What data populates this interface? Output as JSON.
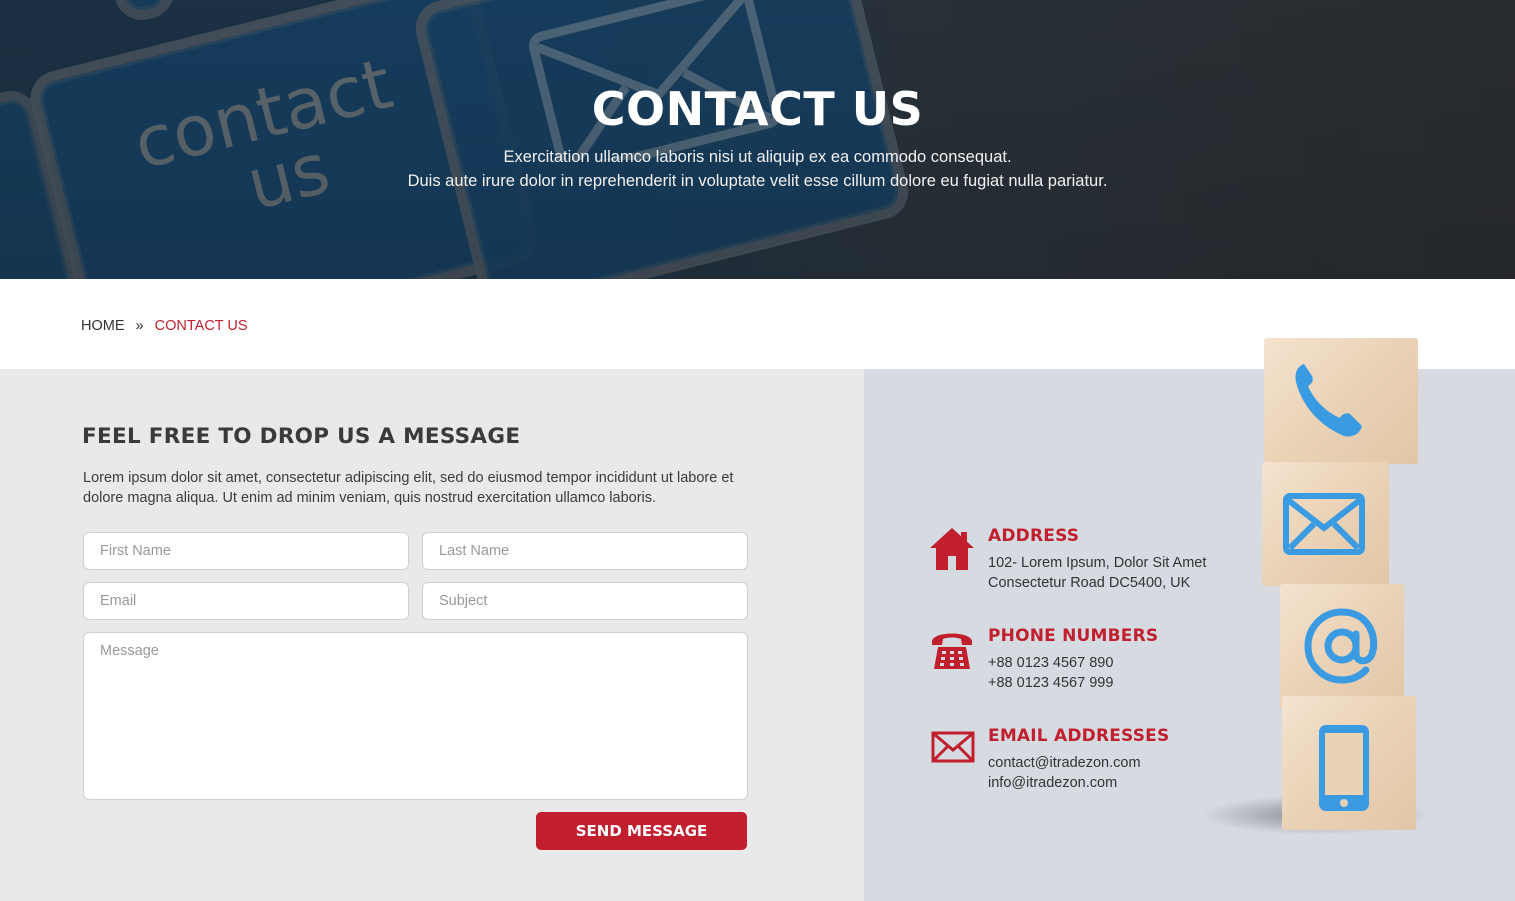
{
  "hero": {
    "title": "CONTACT US",
    "subtitle_line1": "Exercitation ullamco laboris nisi ut aliquip ex ea commodo consequat.",
    "subtitle_line2": "Duis aute irure dolor in reprehenderit in voluptate velit esse cillum dolore eu fugiat nulla pariatur.",
    "background_key_text_line1": "contact",
    "background_key_text_line2": "us"
  },
  "breadcrumb": {
    "home": "HOME",
    "separator": "»",
    "current": "CONTACT US"
  },
  "form": {
    "title": "FEEL FREE TO DROP US A MESSAGE",
    "description": "Lorem ipsum dolor sit amet, consectetur adipiscing elit, sed do eiusmod tempor incididunt ut labore et dolore magna aliqua. Ut enim ad minim veniam, quis nostrud exercitation ullamco laboris.",
    "first_name_placeholder": "First Name",
    "last_name_placeholder": "Last Name",
    "email_placeholder": "Email",
    "subject_placeholder": "Subject",
    "message_placeholder": "Message",
    "submit_label": "SEND MESSAGE"
  },
  "contact_info": {
    "address": {
      "icon": "home-icon",
      "heading": "ADDRESS",
      "line1": "102- Lorem Ipsum, Dolor Sit Amet",
      "line2": "Consectetur Road DC5400, UK"
    },
    "phone": {
      "icon": "telephone-icon",
      "heading": "PHONE NUMBERS",
      "line1": "+88 0123 4567 890",
      "line2": "+88 0123 4567 999"
    },
    "email": {
      "icon": "envelope-icon",
      "heading": "EMAIL ADDRESSES",
      "line1": "contact@itradezon.com",
      "line2": "info@itradezon.com"
    }
  },
  "cubes": {
    "icons": [
      "phone-icon",
      "mail-icon",
      "at-sign-icon",
      "mobile-icon"
    ]
  },
  "colors": {
    "accent": "#c11f2e",
    "cube_icon_blue": "#3a9be2",
    "form_bg": "#e9e9e9",
    "info_bg": "#d6dbe2"
  }
}
